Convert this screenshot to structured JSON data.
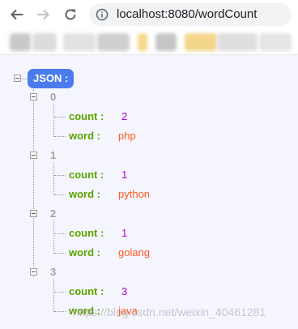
{
  "browser": {
    "url": "localhost:8080/wordCount",
    "back_icon": "arrow-left-icon",
    "forward_icon": "arrow-right-icon",
    "reload_icon": "reload-icon",
    "info_icon": "info-circle-icon"
  },
  "json": {
    "root_label": "JSON :",
    "items": [
      {
        "index": "0",
        "count_key": "count :",
        "count": "2",
        "word_key": "word :",
        "word": "php"
      },
      {
        "index": "1",
        "count_key": "count :",
        "count": "1",
        "word_key": "word :",
        "word": "python"
      },
      {
        "index": "2",
        "count_key": "count :",
        "count": "1",
        "word_key": "word :",
        "word": "golang"
      },
      {
        "index": "3",
        "count_key": "count :",
        "count": "3",
        "word_key": "word :",
        "word": "java"
      }
    ]
  },
  "watermark": "https://blog.csdn.net/weixin_40461281",
  "colors": {
    "badge": "#4b7bec",
    "key": "#5ba300",
    "number": "#b000d8",
    "string": "#ff5a1f",
    "viewer_bg": "#f5f5fd"
  }
}
